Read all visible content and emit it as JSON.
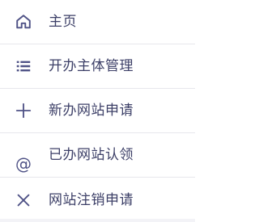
{
  "menu": {
    "items": [
      {
        "label": "主页",
        "icon": "home-icon"
      },
      {
        "label": "开办主体管理",
        "icon": "list-icon"
      },
      {
        "label": "新办网站申请",
        "icon": "plus-icon"
      },
      {
        "label": "已办网站认领",
        "icon": "at-icon"
      },
      {
        "label": "网站注销申请",
        "icon": "close-icon"
      }
    ]
  },
  "colors": {
    "icon": "#4f5286",
    "text": "#3c3f67",
    "divider": "#e7e7ec",
    "background": "#ffffff"
  }
}
